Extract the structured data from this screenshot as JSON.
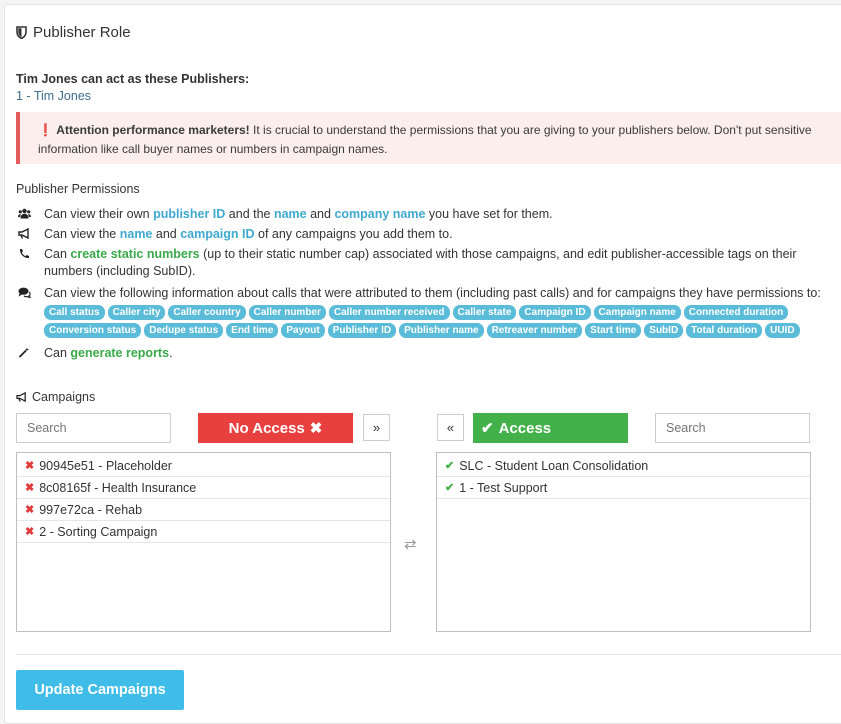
{
  "header": {
    "title": "Publisher Role"
  },
  "acting": {
    "label": "Tim Jones can act as these Publishers:",
    "value": "1 - Tim Jones"
  },
  "alert": {
    "strong": "Attention performance marketers!",
    "text": " It is crucial to understand the permissions that you are giving to your publishers below. Don't put sensitive information like call buyer names or numbers in campaign names."
  },
  "permissions": {
    "heading": "Publisher Permissions",
    "row1": {
      "t1": "Can view their own ",
      "h1": "publisher ID",
      "t2": " and the ",
      "h2": "name",
      "t3": " and ",
      "h3": "company name",
      "t4": " you have set for them."
    },
    "row2": {
      "t1": "Can view the ",
      "h1": "name",
      "t2": " and ",
      "h2": "campaign ID",
      "t3": " of any campaigns you add them to."
    },
    "row3": {
      "t1": "Can ",
      "h1": "create static numbers",
      "t2": " (up to their static number cap) associated with those campaigns, and edit publisher-accessible tags on their numbers (including SubID)."
    },
    "row4": {
      "t1": "Can view the following information about calls that were attributed to them (including past calls) and for campaigns they have permissions to:"
    },
    "tags": [
      "Call status",
      "Caller city",
      "Caller country",
      "Caller number",
      "Caller number received",
      "Caller state",
      "Campaign ID",
      "Campaign name",
      "Connected duration",
      "Conversion status",
      "Dedupe status",
      "End time",
      "Payout",
      "Publisher ID",
      "Publisher name",
      "Retreaver number",
      "Start time",
      "SubID",
      "Total duration",
      "UUID"
    ],
    "row5": {
      "t1": "Can ",
      "h1": "generate reports",
      "t2": "."
    }
  },
  "campaigns": {
    "title": "Campaigns",
    "search_left_placeholder": "Search",
    "search_right_placeholder": "Search",
    "no_access_label": "No Access",
    "access_label": "Access",
    "move_right": "»",
    "move_left": "«",
    "no_access_items": [
      "90945e51 - Placeholder",
      "8c08165f - Health Insurance",
      "997e72ca - Rehab",
      "2 - Sorting Campaign"
    ],
    "access_items": [
      "SLC - Student Loan Consolidation",
      "1 - Test Support"
    ],
    "update_button": "Update Campaigns"
  },
  "colors": {
    "no_access": "#e8403f",
    "access": "#43b14a",
    "highlight": "#3fa9cf",
    "tag": "#5bbcd9",
    "update": "#3fbde8"
  }
}
